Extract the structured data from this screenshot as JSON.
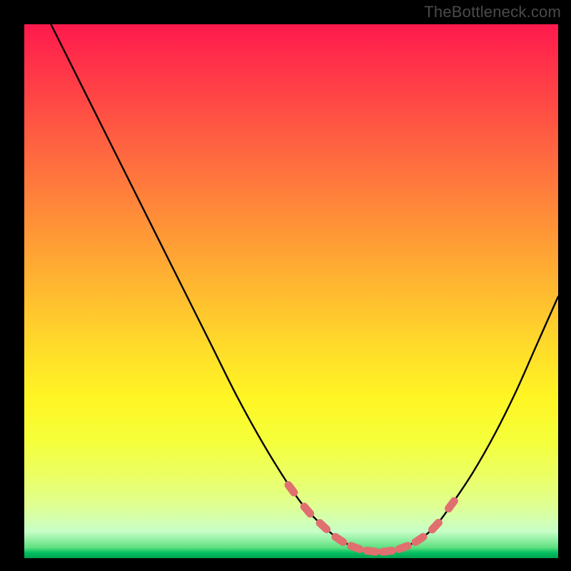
{
  "watermark": "TheBottleneck.com",
  "colors": {
    "frame": "#000000",
    "gradient_top": "#ff1a4d",
    "gradient_mid": "#ffda2a",
    "gradient_bottom": "#00a050",
    "curve": "#000000",
    "marker": "#e07070"
  },
  "chart_data": {
    "type": "line",
    "title": "",
    "xlabel": "",
    "ylabel": "",
    "xlim": [
      0,
      100
    ],
    "ylim": [
      0,
      100
    ],
    "series": [
      {
        "name": "bottleneck-curve",
        "x": [
          5,
          10,
          15,
          20,
          25,
          30,
          35,
          40,
          45,
          50,
          53,
          56,
          59,
          62,
          65,
          68,
          71,
          74,
          77,
          80,
          84,
          88,
          92,
          96,
          100
        ],
        "y": [
          100,
          90,
          80,
          70,
          60,
          50,
          40,
          30,
          21,
          13,
          9,
          6,
          3.5,
          2,
          1.3,
          1.3,
          2,
          3.5,
          6,
          10,
          16,
          23,
          31,
          40,
          49
        ]
      }
    ],
    "markers": {
      "name": "highlight-band",
      "x": [
        50,
        53,
        56,
        59,
        62,
        65,
        68,
        71,
        74,
        77,
        80
      ],
      "y": [
        13,
        9,
        6,
        3.5,
        2,
        1.3,
        1.3,
        2,
        3.5,
        6,
        10
      ]
    }
  }
}
